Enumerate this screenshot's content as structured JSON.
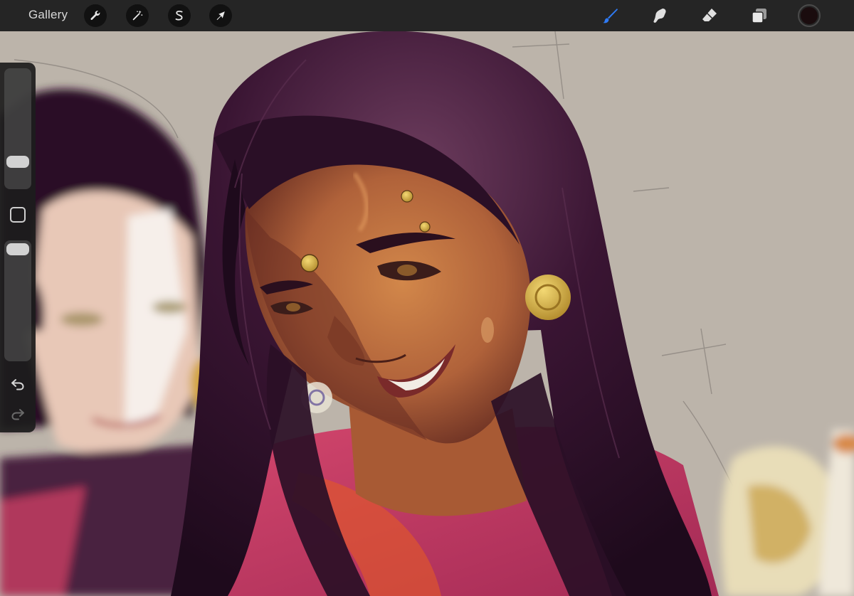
{
  "toolbar": {
    "gallery_label": "Gallery",
    "left_tools": [
      {
        "icon": "wrench-icon",
        "name": "actions"
      },
      {
        "icon": "magic-wand-icon",
        "name": "adjustments"
      },
      {
        "icon": "selection-s-icon",
        "name": "selection"
      },
      {
        "icon": "arrow-cursor-icon",
        "name": "transform"
      }
    ],
    "right_tools": [
      {
        "icon": "brush-icon",
        "name": "brush",
        "active": true
      },
      {
        "icon": "smudge-icon",
        "name": "smudge",
        "active": false
      },
      {
        "icon": "eraser-icon",
        "name": "eraser",
        "active": false
      },
      {
        "icon": "layers-icon",
        "name": "layers",
        "active": false
      }
    ],
    "current_color": "#1a0c0e",
    "active_color": "#2f7bf5"
  },
  "sidebar": {
    "brush_size_level": 0.18,
    "opacity_level": 1.0,
    "undo_icon": "undo-icon",
    "redo_icon": "redo-icon",
    "modify_icon": "square-icon"
  },
  "canvas": {
    "background_color": "#bcb4aa",
    "hair_color": "#2a0f26",
    "skin_color": "#b5693a",
    "garment_color": "#c23d63",
    "jewelry_color": "#d9b84a"
  }
}
